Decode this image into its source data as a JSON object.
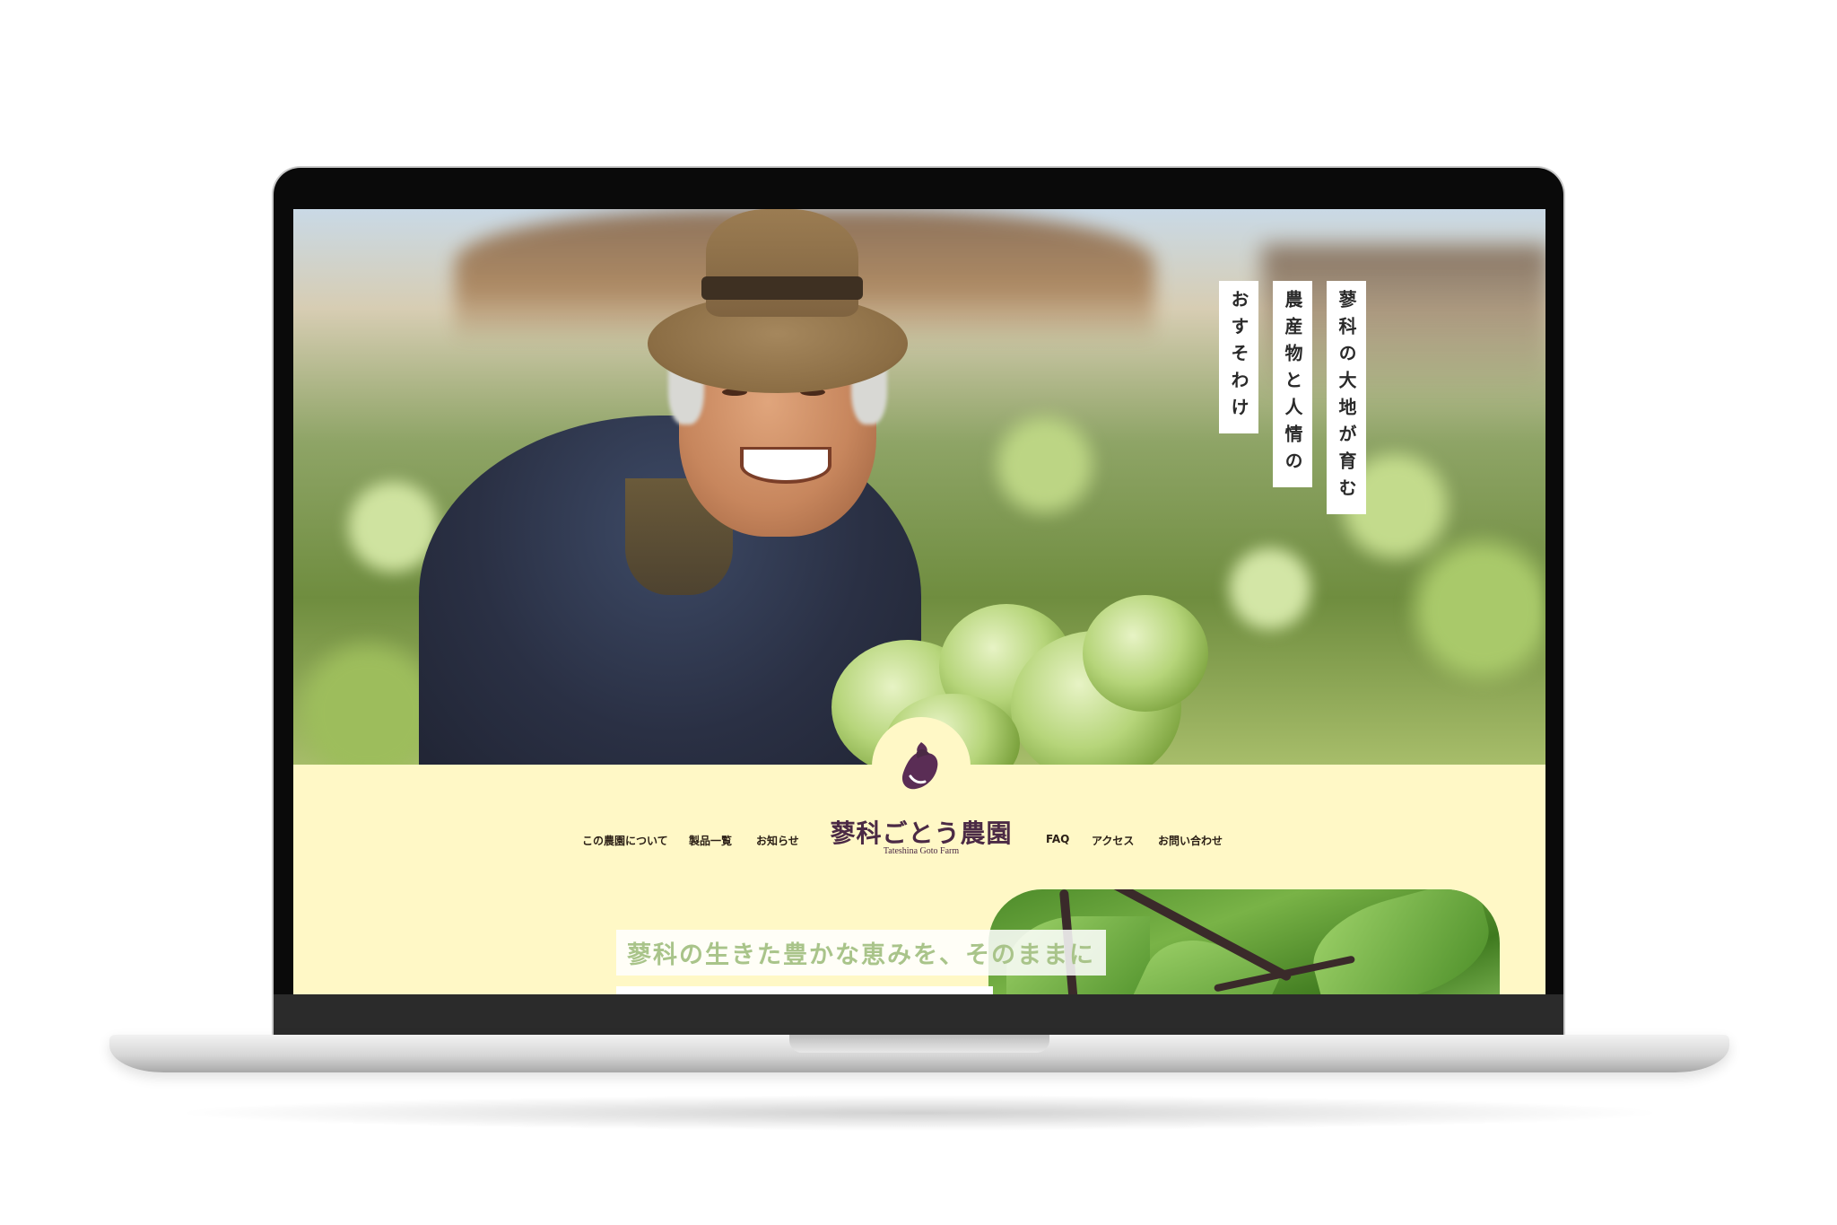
{
  "hero": {
    "tagline_lines": [
      "蓼科の大地が育む",
      "農産物と人情の",
      "おすそわけ"
    ]
  },
  "header": {
    "brand_name": "蓼科ごとう農園",
    "brand_sub": "Tateshina Goto Farm",
    "logo_icon": "eggplant-icon",
    "nav_left": [
      "この農園について",
      "製品一覧",
      "お知らせ"
    ],
    "nav_right": [
      "FAQ",
      "アクセス",
      "お問い合わせ"
    ]
  },
  "main": {
    "headline": "蓼科の生きた豊かな恵みを、そのままに"
  },
  "colors": {
    "cream": "#fff8c6",
    "brand_purple": "#4b2a45",
    "headline_green": "#a9c48a"
  }
}
